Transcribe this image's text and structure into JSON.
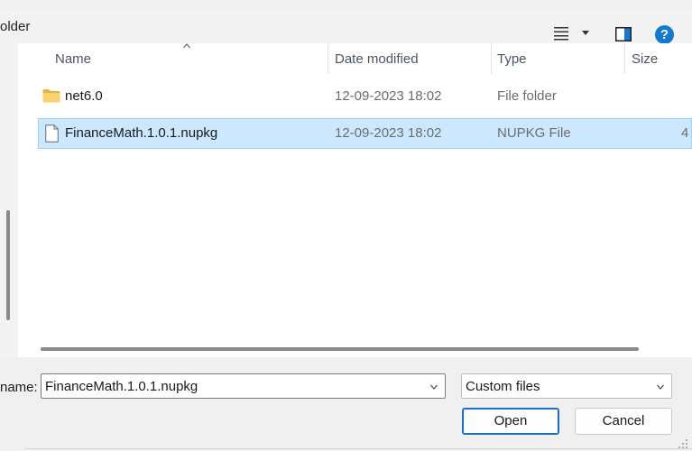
{
  "toolbar": {
    "location_fragment": "older",
    "help_label": "?"
  },
  "columns": {
    "name": "Name",
    "date": "Date modified",
    "type": "Type",
    "size": "Size"
  },
  "files": [
    {
      "name": "net6.0",
      "date": "12-09-2023 18:02",
      "type": "File folder",
      "size": "",
      "icon": "folder-icon"
    },
    {
      "name": "FinanceMath.1.0.1.nupkg",
      "date": "12-09-2023 18:02",
      "type": "NUPKG File",
      "size": "4",
      "icon": "document-icon",
      "selected": true
    }
  ],
  "bottom": {
    "filename_label": "name:",
    "filename_value": "FinanceMath.1.0.1.nupkg",
    "filetype_value": "Custom files",
    "open_label": "Open",
    "cancel_label": "Cancel"
  },
  "colors": {
    "selection_bg": "#cce8ff",
    "selection_border": "#99d1ff",
    "accent": "#1479d1"
  }
}
